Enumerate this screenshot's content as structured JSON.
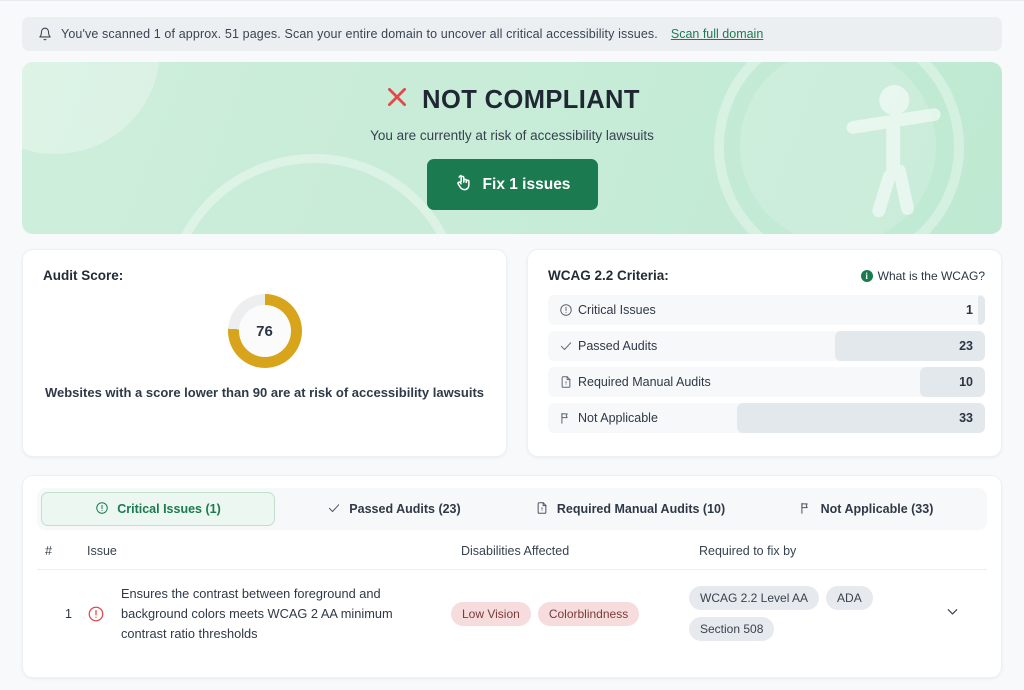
{
  "notice": {
    "icon": "bell-icon",
    "text": "You've scanned 1 of approx. 51 pages. Scan your entire domain to uncover all critical accessibility issues.",
    "link_label": "Scan full domain"
  },
  "hero": {
    "status_icon": "x-mark-icon",
    "title": "NOT COMPLIANT",
    "subtitle": "You are currently at risk of accessibility lawsuits",
    "button_icon": "click-hand-icon",
    "button_label": "Fix 1 issues",
    "watermark_icon": "accessibility-person-icon",
    "accent_color": "#1b7a4f",
    "danger_color": "#e24a4a",
    "background_color": "#c8ecd8"
  },
  "audit": {
    "title": "Audit Score:",
    "score": "76",
    "score_value": 76,
    "score_color": "#d8a41c",
    "track_color": "#eceef0",
    "note": "Websites with a score lower than 90 are at risk of accessibility lawsuits"
  },
  "wcag": {
    "title": "WCAG 2.2 Criteria:",
    "link_label": "What is the WCAG?",
    "link_icon": "info-icon",
    "rows": [
      {
        "icon": "alert-circle-icon",
        "label": "Critical Issues",
        "value": "1",
        "fill_pct": 1.5
      },
      {
        "icon": "check-icon",
        "label": "Passed Audits",
        "value": "23",
        "fill_pct": 34.3
      },
      {
        "icon": "document-icon",
        "label": "Required Manual Audits",
        "value": "10",
        "fill_pct": 14.9
      },
      {
        "icon": "flag-icon",
        "label": "Not Applicable",
        "value": "33",
        "fill_pct": 56.7
      }
    ]
  },
  "panel": {
    "tabs": [
      {
        "icon": "alert-circle-icon",
        "label": "Critical Issues (1)",
        "active": true
      },
      {
        "icon": "check-icon",
        "label": "Passed Audits (23)",
        "active": false
      },
      {
        "icon": "document-icon",
        "label": "Required Manual Audits (10)",
        "active": false
      },
      {
        "icon": "flag-icon",
        "label": "Not Applicable (33)",
        "active": false
      }
    ],
    "columns": {
      "number": "#",
      "issue": "Issue",
      "disabilities": "Disabilities Affected",
      "required": "Required to fix by"
    },
    "rows": [
      {
        "number": "1",
        "severity_icon": "alert-circle-icon",
        "issue": "Ensures the contrast between foreground and background colors meets WCAG 2 AA minimum contrast ratio thresholds",
        "disabilities": [
          "Low Vision",
          "Colorblindness"
        ],
        "required": [
          "WCAG 2.2 Level AA",
          "ADA",
          "Section 508"
        ],
        "expand_icon": "chevron-down-icon"
      }
    ]
  }
}
